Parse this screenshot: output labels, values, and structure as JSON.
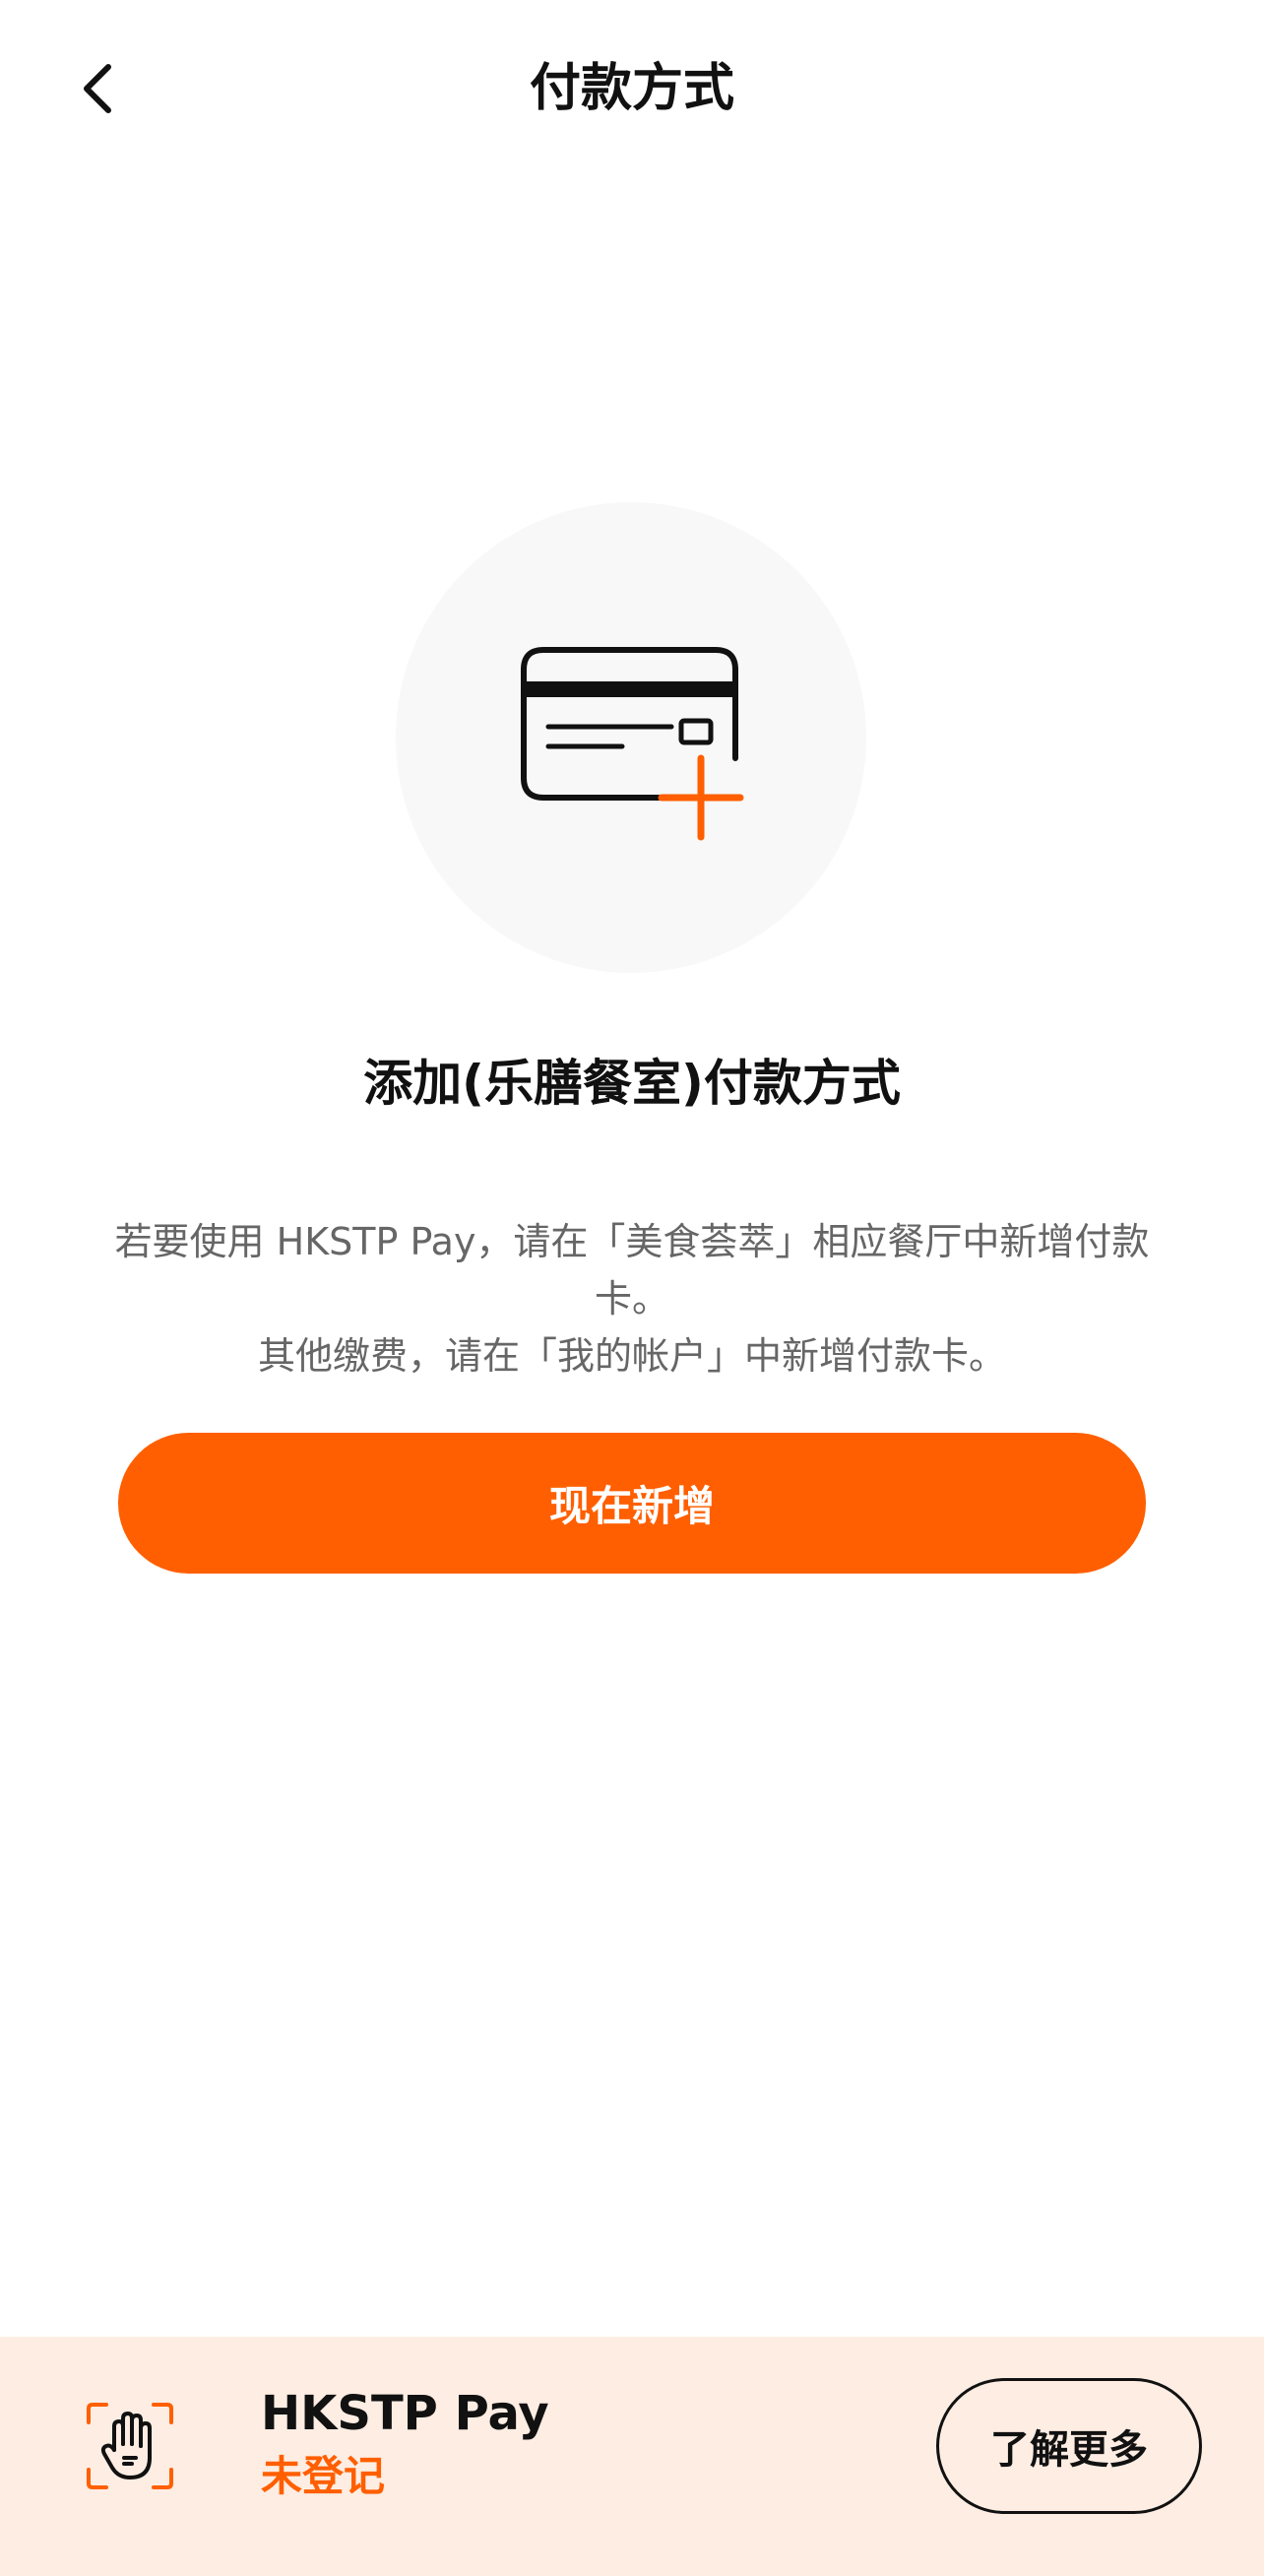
{
  "header": {
    "title": "付款方式",
    "back_icon": "chevron-left-icon"
  },
  "main": {
    "illustration_icon": "credit-card-add-icon",
    "accent_color": "#ff5f00",
    "heading": "添加(乐膳餐室)付款方式",
    "description_line1": "若要使用 HKSTP Pay，请在「美食荟萃」相应餐厅中新增付款卡。",
    "description_line2": "其他缴费，请在「我的帐户」中新增付款卡。",
    "add_button_label": "现在新增"
  },
  "bottom_bar": {
    "icon": "palm-scan-icon",
    "pay_name": "HKSTP Pay",
    "status": "未登记",
    "learn_more_label": "了解更多",
    "background_color": "#fdede3"
  }
}
